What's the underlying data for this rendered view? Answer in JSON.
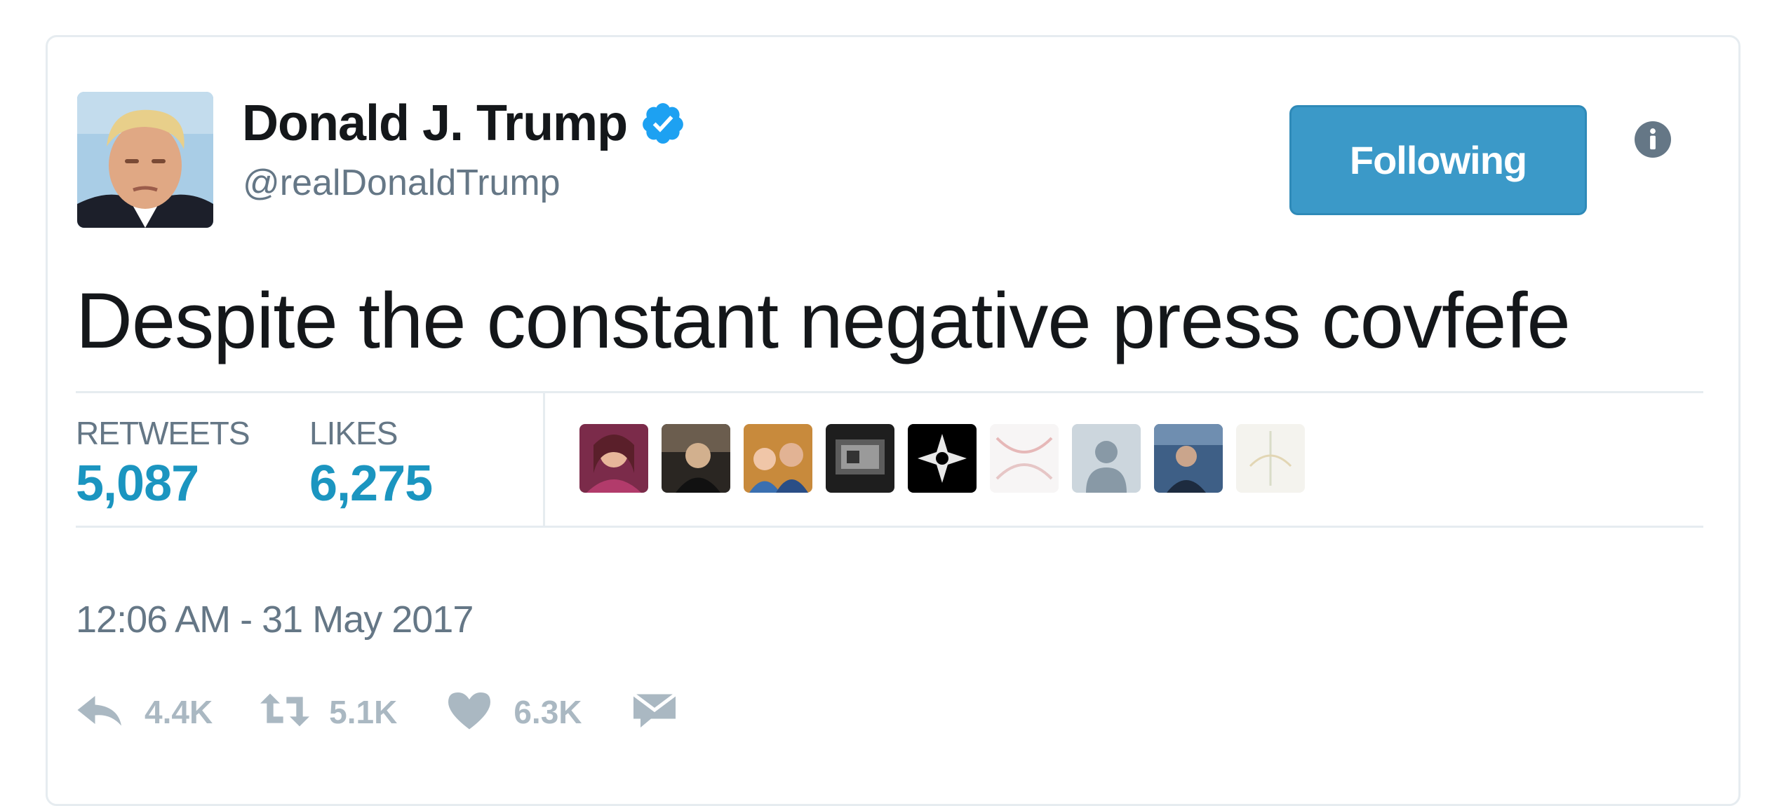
{
  "tweet": {
    "author": {
      "display_name": "Donald J. Trump",
      "handle": "@realDonaldTrump",
      "verified": true
    },
    "follow_button_label": "Following",
    "text": "Despite the constant negative press covfefe",
    "stats": {
      "retweets_label": "RETWEETS",
      "retweets_value": "5,087",
      "likes_label": "LIKES",
      "likes_value": "6,275"
    },
    "liker_avatars": [
      {
        "icon": "user-avatar"
      },
      {
        "icon": "user-avatar"
      },
      {
        "icon": "user-avatar"
      },
      {
        "icon": "user-avatar"
      },
      {
        "icon": "user-avatar"
      },
      {
        "icon": "user-avatar"
      },
      {
        "icon": "default-user-avatar"
      },
      {
        "icon": "user-avatar"
      },
      {
        "icon": "user-avatar"
      }
    ],
    "timestamp": "12:06 AM - 31 May 2017",
    "actions": {
      "reply_count": "4.4K",
      "retweet_count": "5.1K",
      "like_count": "6.3K"
    }
  },
  "colors": {
    "accent": "#3b99c8",
    "verified": "#1da1f2",
    "count_blue": "#1b95c0",
    "muted_text": "#657786",
    "action_gray": "#aab8c2",
    "border": "#e6ecf0"
  },
  "icons": {
    "verified": "verified-badge-icon",
    "info": "info-icon",
    "reply": "reply-icon",
    "retweet": "retweet-icon",
    "like": "heart-icon",
    "message": "direct-message-icon"
  }
}
